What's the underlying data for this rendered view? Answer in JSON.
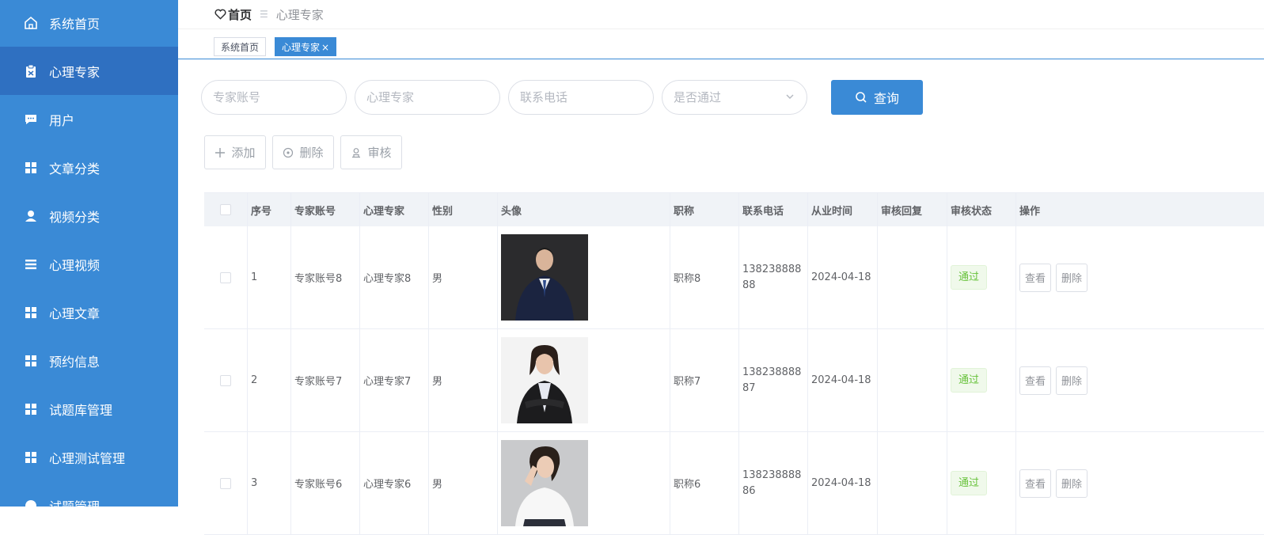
{
  "sidebar": {
    "items": [
      {
        "label": "系统首页",
        "icon": "home-icon"
      },
      {
        "label": "心理专家",
        "icon": "clipboard-icon",
        "active": true
      },
      {
        "label": "用户",
        "icon": "chat-icon"
      },
      {
        "label": "文章分类",
        "icon": "grid-icon"
      },
      {
        "label": "视频分类",
        "icon": "user-icon"
      },
      {
        "label": "心理视频",
        "icon": "list-icon"
      },
      {
        "label": "心理文章",
        "icon": "grid-icon"
      },
      {
        "label": "预约信息",
        "icon": "grid-icon"
      },
      {
        "label": "试题库管理",
        "icon": "grid-icon"
      },
      {
        "label": "心理测试管理",
        "icon": "grid-icon"
      },
      {
        "label": "试题管理",
        "icon": "globe-icon"
      }
    ]
  },
  "breadcrumb": {
    "home": "首页",
    "current": "心理专家"
  },
  "tabs": [
    {
      "label": "系统首页"
    },
    {
      "label": "心理专家",
      "close": "×"
    }
  ],
  "search": {
    "account_placeholder": "专家账号",
    "name_placeholder": "心理专家",
    "phone_placeholder": "联系电话",
    "status_placeholder": "是否通过",
    "button": "查询"
  },
  "actions": {
    "add": "添加",
    "delete": "删除",
    "review": "审核"
  },
  "table": {
    "headers": [
      "序号",
      "专家账号",
      "心理专家",
      "性别",
      "头像",
      "职称",
      "联系电话",
      "从业时间",
      "审核回复",
      "审核状态",
      "操作"
    ],
    "rows": [
      {
        "index": "1",
        "account": "专家账号8",
        "name": "心理专家8",
        "gender": "男",
        "title": "职称8",
        "phone": "13823888888",
        "time": "2024-04-18",
        "reply": "",
        "status": "通过"
      },
      {
        "index": "2",
        "account": "专家账号7",
        "name": "心理专家7",
        "gender": "男",
        "title": "职称7",
        "phone": "13823888887",
        "time": "2024-04-18",
        "reply": "",
        "status": "通过"
      },
      {
        "index": "3",
        "account": "专家账号6",
        "name": "心理专家6",
        "gender": "男",
        "title": "职称6",
        "phone": "13823888886",
        "time": "2024-04-18",
        "reply": "",
        "status": "通过"
      }
    ],
    "view_label": "查看",
    "delete_label": "删除"
  },
  "colors": {
    "sidebar": "#3a8ad6",
    "sidebar_active": "#2f70c1",
    "primary": "#3a8ad6",
    "success": "#67c23a"
  }
}
